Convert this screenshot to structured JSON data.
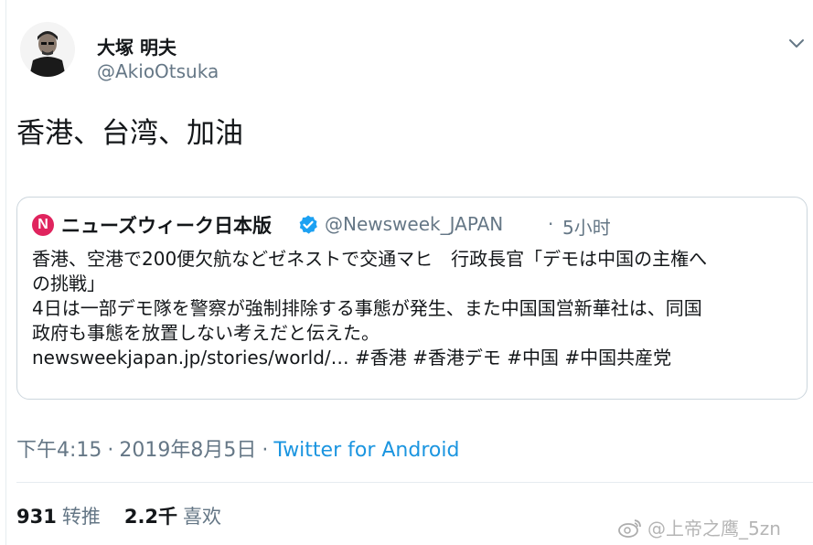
{
  "author": {
    "display_name": "大塚 明夫",
    "handle": "@AkioOtsuka"
  },
  "tweet": {
    "text": "香港、台湾、加油"
  },
  "quoted_tweet": {
    "logo_letter": "N",
    "name": "ニューズウィーク日本版",
    "handle": "@Newsweek_JAPAN",
    "separator": "·",
    "time": "5小时",
    "lines": [
      "香港、空港で200便欠航などゼネストで交通マヒ　行政長官「デモは中国の主権へ",
      "の挑戦」",
      "4日は一部デモ隊を警察が強制排除する事態が発生、また中国国営新華社は、同国",
      "政府も事態を放置しない考えだと伝えた。",
      "newsweekjapan.jp/stories/world/… #香港 #香港デモ #中国 #中国共産党"
    ]
  },
  "meta": {
    "time": "下午4:15",
    "separator": "·",
    "date": "2019年8月5日",
    "client": "Twitter for Android"
  },
  "stats": {
    "retweets_count": "931",
    "retweets_label": "转推",
    "likes_count": "2.2千",
    "likes_label": "喜欢"
  },
  "watermark": {
    "text": "@上帝之鹰_5zn"
  },
  "icons": {
    "chevron": "chevron-down-icon",
    "verified": "verified-badge-icon",
    "weibo": "weibo-icon"
  },
  "colors": {
    "link": "#1b95e0",
    "secondary_text": "#657786",
    "border": "#ccd6dd",
    "verified": "#1da1f2",
    "newsweek_red": "#e0245e"
  }
}
